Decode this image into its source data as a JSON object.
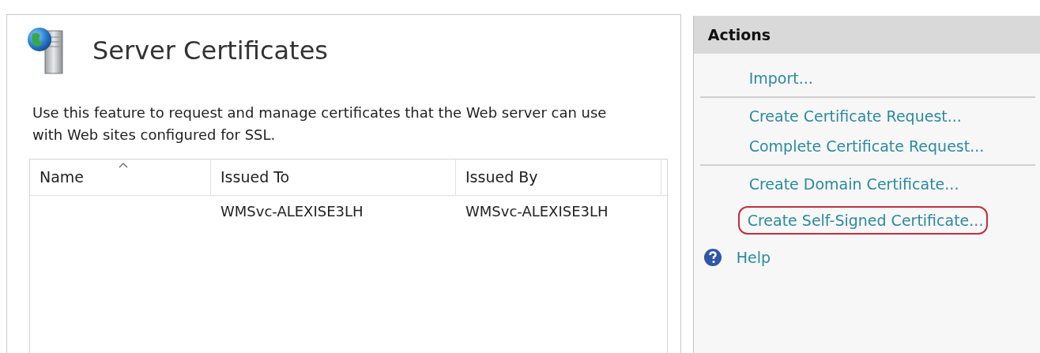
{
  "feature": {
    "title": "Server Certificates",
    "description": "Use this feature to request and manage certificates that the Web server can use with Web sites configured for SSL."
  },
  "table": {
    "columns": [
      {
        "label": "Name",
        "sorted": true
      },
      {
        "label": "Issued To",
        "sorted": false
      },
      {
        "label": "Issued By",
        "sorted": false
      }
    ],
    "rows": [
      {
        "cells": [
          "",
          "WMSvc-ALEXISE3LH",
          "WMSvc-ALEXISE3LH"
        ]
      }
    ]
  },
  "actions": {
    "title": "Actions",
    "groups": [
      [
        {
          "label": "Import...",
          "kind": "link",
          "highlighted": false
        }
      ],
      [
        {
          "label": "Create Certificate Request...",
          "kind": "link",
          "highlighted": false
        },
        {
          "label": "Complete Certificate Request...",
          "kind": "link",
          "highlighted": false
        }
      ],
      [
        {
          "label": "Create Domain Certificate...",
          "kind": "link",
          "highlighted": false
        }
      ],
      [
        {
          "label": "Create Self-Signed Certificate...",
          "kind": "link",
          "highlighted": true
        }
      ],
      [
        {
          "label": "Help",
          "kind": "help",
          "highlighted": false
        }
      ]
    ]
  }
}
